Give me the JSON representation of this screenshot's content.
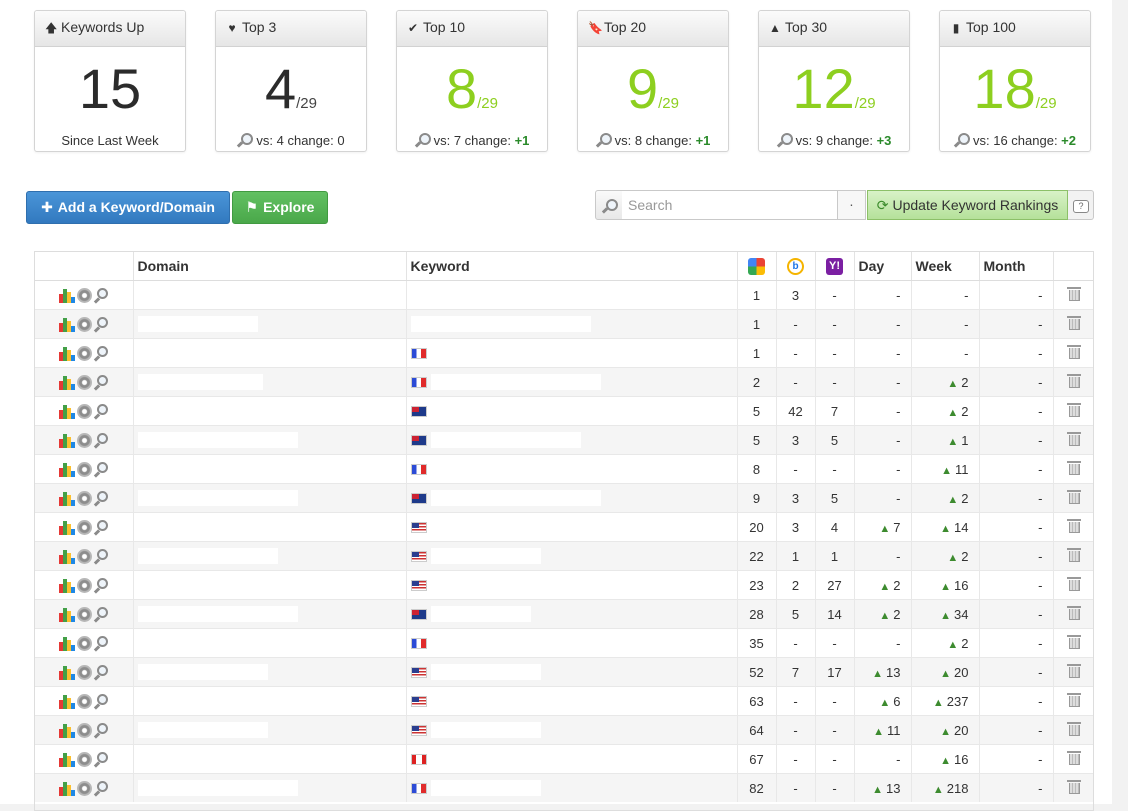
{
  "stats": [
    {
      "icon": "arrow-up-icon",
      "icon_glyph": "🡅",
      "title": "Keywords Up",
      "value": "15",
      "denominator": "",
      "value_color": "dark",
      "footer_text": "Since Last Week",
      "vs": "",
      "change": ""
    },
    {
      "icon": "heart-icon",
      "icon_glyph": "♥",
      "title": "Top 3",
      "value": "4",
      "denominator": "/29",
      "value_color": "dark",
      "footer_text": "vs: 4 change: 0",
      "vs": "",
      "change": ""
    },
    {
      "icon": "check-icon",
      "icon_glyph": "✔",
      "title": "Top 10",
      "value": "8",
      "denominator": "/29",
      "value_color": "green",
      "footer_text": "vs: 7 change: ",
      "change": "+1"
    },
    {
      "icon": "bookmark-icon",
      "icon_glyph": "🔖",
      "title": "Top 20",
      "value": "9",
      "denominator": "/29",
      "value_color": "green",
      "footer_text": "vs: 8 change: ",
      "change": "+1"
    },
    {
      "icon": "road-icon",
      "icon_glyph": "▲",
      "title": "Top 30",
      "value": "12",
      "denominator": "/29",
      "value_color": "green",
      "footer_text": "vs: 9 change: ",
      "change": "+3"
    },
    {
      "icon": "signal-icon",
      "icon_glyph": "▮",
      "title": "Top 100",
      "value": "18",
      "denominator": "/29",
      "value_color": "green",
      "footer_text": "vs: 16 change: ",
      "change": "+2"
    }
  ],
  "toolbar": {
    "add_label": "Add a Keyword/Domain",
    "explore_label": "Explore",
    "search_placeholder": "Search",
    "dot_label": "·",
    "update_label": "Update Keyword Rankings"
  },
  "table": {
    "headers": {
      "domain": "Domain",
      "keyword": "Keyword",
      "day": "Day",
      "week": "Week",
      "month": "Month"
    },
    "rows": [
      {
        "domain": "",
        "keyword": "",
        "flag": "",
        "google": "1",
        "bing": "3",
        "yahoo": "-",
        "day": "-",
        "day_up": false,
        "week": "-",
        "week_up": false,
        "month": "-"
      },
      {
        "domain": "",
        "keyword": "",
        "flag": "",
        "google": "1",
        "bing": "-",
        "yahoo": "-",
        "day": "-",
        "day_up": false,
        "week": "-",
        "week_up": false,
        "month": "-"
      },
      {
        "domain": "",
        "keyword": "",
        "flag": "fr",
        "google": "1",
        "bing": "-",
        "yahoo": "-",
        "day": "-",
        "day_up": false,
        "week": "-",
        "week_up": false,
        "month": "-"
      },
      {
        "domain": "",
        "keyword": "",
        "flag": "fr",
        "google": "2",
        "bing": "-",
        "yahoo": "-",
        "day": "-",
        "day_up": false,
        "week": "2",
        "week_up": true,
        "month": "-"
      },
      {
        "domain": "",
        "keyword": "",
        "flag": "au",
        "google": "5",
        "bing": "42",
        "yahoo": "7",
        "day": "-",
        "day_up": false,
        "week": "2",
        "week_up": true,
        "month": "-"
      },
      {
        "domain": "",
        "keyword": "",
        "flag": "au",
        "google": "5",
        "bing": "3",
        "yahoo": "5",
        "day": "-",
        "day_up": false,
        "week": "1",
        "week_up": true,
        "month": "-"
      },
      {
        "domain": "",
        "keyword": "",
        "flag": "fr",
        "google": "8",
        "bing": "-",
        "yahoo": "-",
        "day": "-",
        "day_up": false,
        "week": "11",
        "week_up": true,
        "month": "-"
      },
      {
        "domain": "",
        "keyword": "",
        "flag": "au",
        "google": "9",
        "bing": "3",
        "yahoo": "5",
        "day": "-",
        "day_up": false,
        "week": "2",
        "week_up": true,
        "month": "-"
      },
      {
        "domain": "",
        "keyword": "",
        "flag": "us",
        "google": "20",
        "bing": "3",
        "yahoo": "4",
        "day": "7",
        "day_up": true,
        "week": "14",
        "week_up": true,
        "month": "-"
      },
      {
        "domain": "",
        "keyword": "",
        "flag": "us",
        "google": "22",
        "bing": "1",
        "yahoo": "1",
        "day": "-",
        "day_up": false,
        "week": "2",
        "week_up": true,
        "month": "-"
      },
      {
        "domain": "",
        "keyword": "",
        "flag": "us",
        "google": "23",
        "bing": "2",
        "yahoo": "27",
        "day": "2",
        "day_up": true,
        "week": "16",
        "week_up": true,
        "month": "-"
      },
      {
        "domain": "",
        "keyword": "",
        "flag": "au",
        "google": "28",
        "bing": "5",
        "yahoo": "14",
        "day": "2",
        "day_up": true,
        "week": "34",
        "week_up": true,
        "month": "-"
      },
      {
        "domain": "",
        "keyword": "",
        "flag": "fr",
        "google": "35",
        "bing": "-",
        "yahoo": "-",
        "day": "-",
        "day_up": false,
        "week": "2",
        "week_up": true,
        "month": "-"
      },
      {
        "domain": "",
        "keyword": "",
        "flag": "us",
        "google": "52",
        "bing": "7",
        "yahoo": "17",
        "day": "13",
        "day_up": true,
        "week": "20",
        "week_up": true,
        "month": "-"
      },
      {
        "domain": "",
        "keyword": "",
        "flag": "us",
        "google": "63",
        "bing": "-",
        "yahoo": "-",
        "day": "6",
        "day_up": true,
        "week": "237",
        "week_up": true,
        "month": "-"
      },
      {
        "domain": "",
        "keyword": "",
        "flag": "us",
        "google": "64",
        "bing": "-",
        "yahoo": "-",
        "day": "11",
        "day_up": true,
        "week": "20",
        "week_up": true,
        "month": "-"
      },
      {
        "domain": "",
        "keyword": "",
        "flag": "ca",
        "google": "67",
        "bing": "-",
        "yahoo": "-",
        "day": "-",
        "day_up": false,
        "week": "16",
        "week_up": true,
        "month": "-"
      },
      {
        "domain": "",
        "keyword": "",
        "flag": "fr",
        "google": "82",
        "bing": "-",
        "yahoo": "-",
        "day": "13",
        "day_up": true,
        "week": "218",
        "week_up": true,
        "month": "-"
      }
    ]
  },
  "colors": {
    "green_value": "#8dcf1f",
    "change_green": "#2a8a2a",
    "blue_button": "#3a86cc",
    "green_button": "#52b152",
    "domain_link": "#2a6ebb"
  }
}
